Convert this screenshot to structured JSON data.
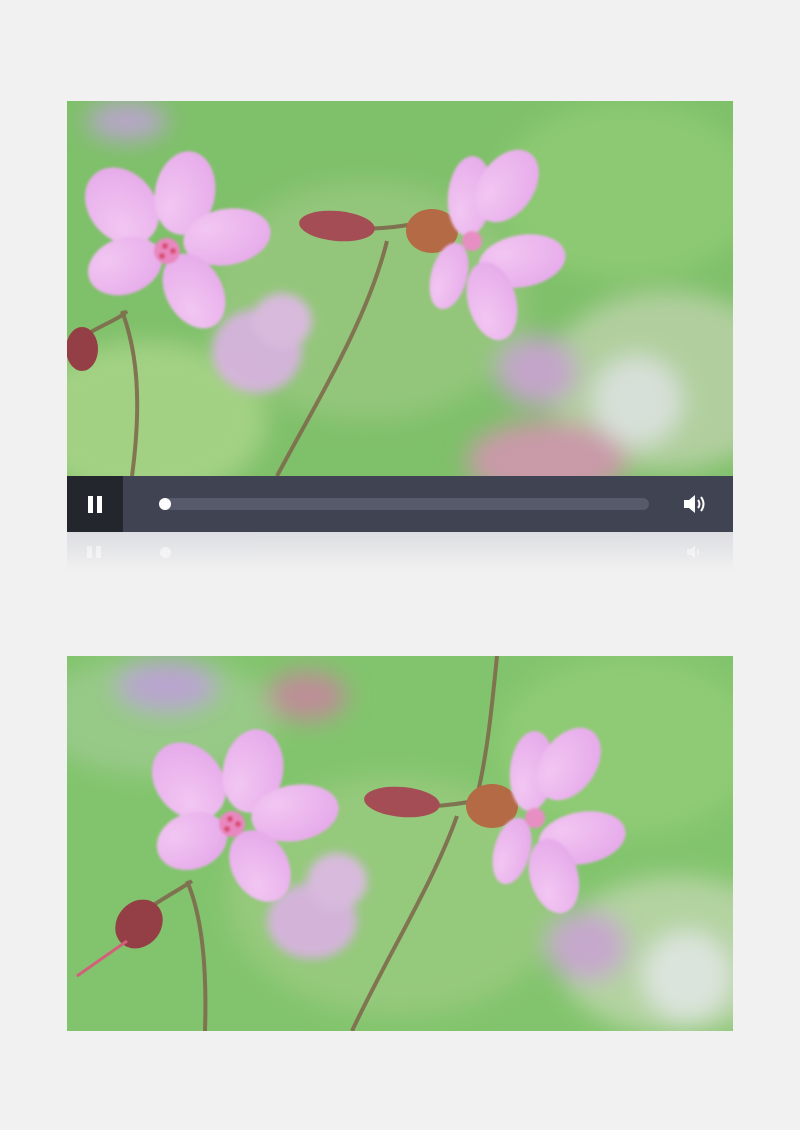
{
  "player": {
    "state": "playing",
    "progress": 0.0,
    "controls": {
      "play_pause_icon": "pause-icon",
      "volume_icon": "volume-icon"
    },
    "colors": {
      "control_bar": "#3f4352",
      "pause_button_bg": "#24262d",
      "track": "#565a6a",
      "thumb": "#ffffff"
    }
  },
  "frames": {
    "top_subject": "pink-wildflowers",
    "bottom_subject": "pink-wildflowers"
  }
}
